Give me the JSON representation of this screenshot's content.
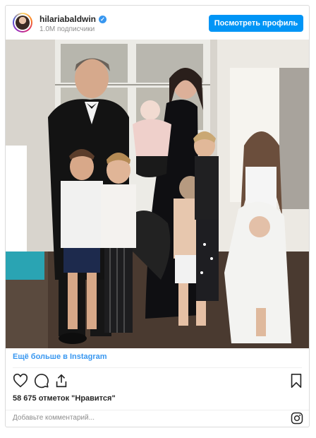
{
  "header": {
    "username": "hilariabaldwin",
    "verified_mark": "✓",
    "followers": "1.0M подписчики",
    "profile_button": "Посмотреть профиль"
  },
  "post": {
    "more_link": "Ещё больше в Instagram",
    "likes": "58 675 отметок \"Нравится\"",
    "comment_placeholder": "Добавьте комментарий..."
  },
  "icons": {
    "like": "heart-icon",
    "comment": "comment-icon",
    "share": "share-icon",
    "save": "bookmark-icon",
    "instagram": "instagram-icon"
  },
  "colors": {
    "accent": "#0095f6",
    "link": "#3897f0",
    "text": "#262626",
    "muted": "#8e8e8e"
  }
}
